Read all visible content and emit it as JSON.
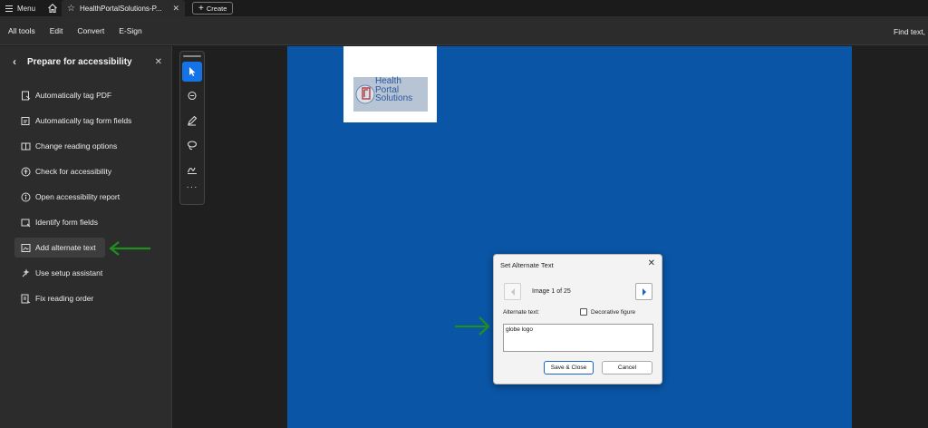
{
  "tabbar": {
    "menu_label": "Menu",
    "doc_tab_title": "HealthPortalSolutions-P...",
    "create_label": "Create"
  },
  "toolbar": {
    "tools": [
      "All tools",
      "Edit",
      "Convert",
      "E-Sign"
    ],
    "find_label": "Find text,"
  },
  "sidebar": {
    "title": "Prepare for accessibility",
    "items": [
      {
        "label": "Automatically tag PDF",
        "icon": "tag-pdf-icon"
      },
      {
        "label": "Automatically tag form fields",
        "icon": "tag-form-icon"
      },
      {
        "label": "Change reading options",
        "icon": "reading-options-icon"
      },
      {
        "label": "Check for accessibility",
        "icon": "accessibility-check-icon"
      },
      {
        "label": "Open accessibility report",
        "icon": "report-icon"
      },
      {
        "label": "Identify form fields",
        "icon": "form-fields-icon"
      },
      {
        "label": "Add alternate text",
        "icon": "alt-text-icon"
      },
      {
        "label": "Use setup assistant",
        "icon": "setup-assistant-icon"
      },
      {
        "label": "Fix reading order",
        "icon": "reading-order-icon"
      }
    ],
    "active_index": 6
  },
  "document": {
    "logo_text": [
      "Health",
      "Portal",
      "Solutions"
    ],
    "page_color": "#0a55a5"
  },
  "dialog": {
    "title": "Set Alternate Text",
    "counter": "Image 1 of 25",
    "alt_label": "Alternate text:",
    "decorative_label": "Decorative figure",
    "alt_value": "globe logo",
    "save_label": "Save & Close",
    "cancel_label": "Cancel"
  },
  "colors": {
    "accent": "#1473e6",
    "annotation_arrow": "#1f8f1f"
  }
}
